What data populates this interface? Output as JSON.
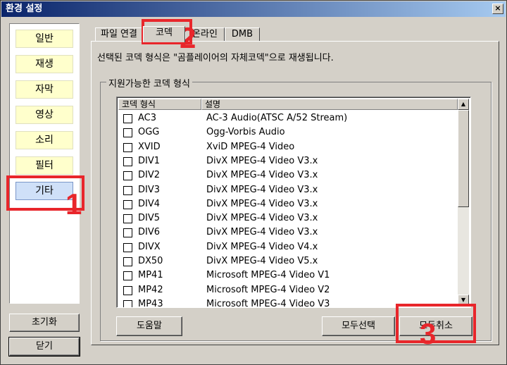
{
  "window": {
    "title": "환경 설정",
    "close_glyph": "×"
  },
  "sidebar": {
    "items": [
      {
        "label": "일반"
      },
      {
        "label": "재생"
      },
      {
        "label": "자막"
      },
      {
        "label": "영상"
      },
      {
        "label": "소리"
      },
      {
        "label": "필터"
      },
      {
        "label": "기타"
      }
    ]
  },
  "bottom_left": {
    "reset_label": "초기화",
    "close_label": "닫기"
  },
  "tabs": [
    {
      "label": "파일 연결"
    },
    {
      "label": "코덱"
    },
    {
      "label": "온라인"
    },
    {
      "label": "DMB"
    }
  ],
  "codec_panel": {
    "description": "선택된 코덱 형식은 \"곰플레이어의 자체코덱\"으로 재생됩니다.",
    "group_title": "지원가능한 코덱 형식",
    "columns": [
      "코덱 형식",
      "설명"
    ],
    "rows": [
      {
        "codec": "AC3",
        "desc": "AC-3 Audio(ATSC A/52 Stream)"
      },
      {
        "codec": "OGG",
        "desc": "Ogg-Vorbis Audio"
      },
      {
        "codec": "XVID",
        "desc": "XviD MPEG-4 Video"
      },
      {
        "codec": "DIV1",
        "desc": "DivX MPEG-4 Video V3.x"
      },
      {
        "codec": "DIV2",
        "desc": "DivX MPEG-4 Video V3.x"
      },
      {
        "codec": "DIV3",
        "desc": "DivX MPEG-4 Video V3.x"
      },
      {
        "codec": "DIV4",
        "desc": "DivX MPEG-4 Video V3.x"
      },
      {
        "codec": "DIV5",
        "desc": "DivX MPEG-4 Video V3.x"
      },
      {
        "codec": "DIV6",
        "desc": "DivX MPEG-4 Video V3.x"
      },
      {
        "codec": "DIVX",
        "desc": "DivX MPEG-4 Video V4.x"
      },
      {
        "codec": "DX50",
        "desc": "DivX MPEG-4 Video V5.x"
      },
      {
        "codec": "MP41",
        "desc": "Microsoft MPEG-4 Video V1"
      },
      {
        "codec": "MP42",
        "desc": "Microsoft MPEG-4 Video V2"
      },
      {
        "codec": "MP43",
        "desc": "Microsoft MPEG-4 Video V3"
      }
    ],
    "help_label": "도움말",
    "select_all_label": "모두선택",
    "deselect_all_label": "모두취소"
  },
  "annotations": {
    "n1": "1",
    "n2": "2",
    "n3": "3",
    "color": "#e8262b"
  },
  "icons": {
    "scroll_up": "▲",
    "scroll_down": "▼"
  }
}
